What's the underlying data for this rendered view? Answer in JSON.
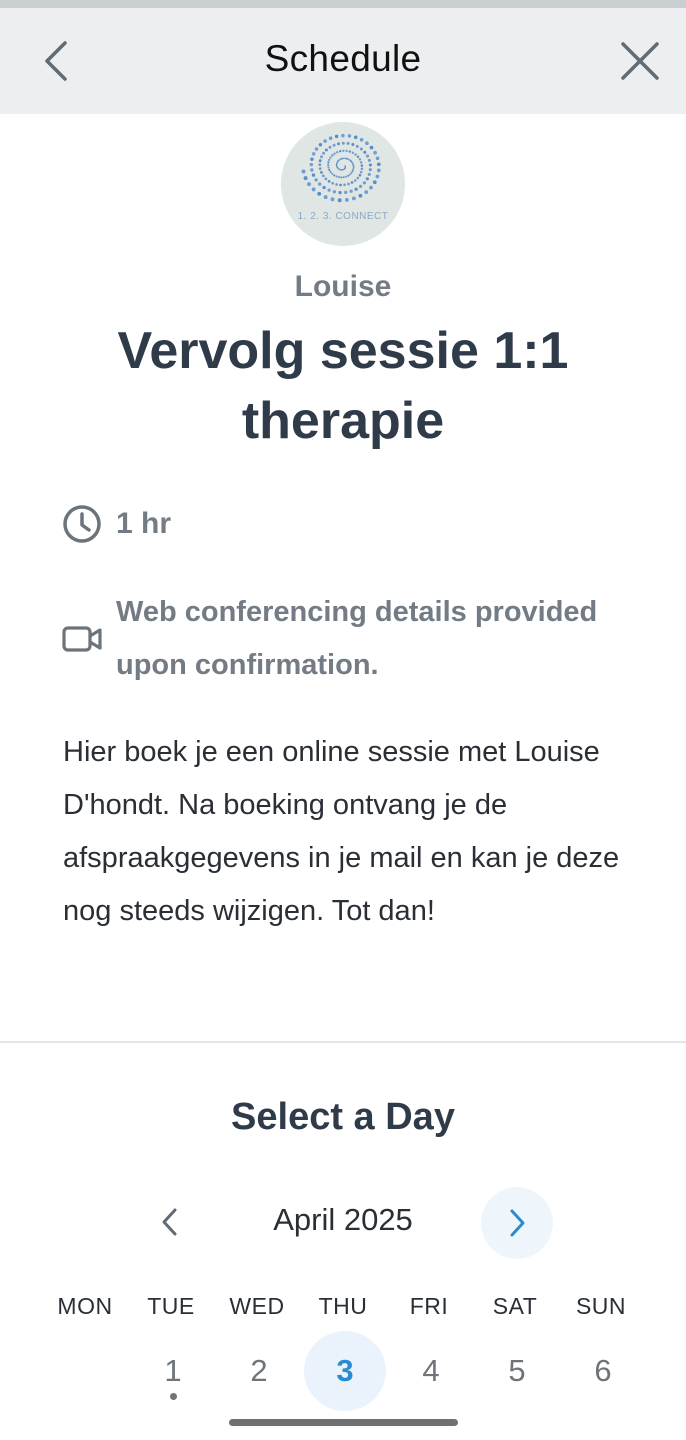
{
  "header": {
    "title": "Schedule"
  },
  "logo": {
    "text": "1. 2. 3. CONNECT"
  },
  "event": {
    "owner": "Louise",
    "title": "Vervolg sessie 1:1 therapie",
    "duration": "1 hr",
    "conferencing": "Web conferencing details provided upon confirmation.",
    "description": "Hier boek je een online sessie met Louise D'hondt. Na boeking ontvang je de afspraakgegevens in je mail en kan je deze nog steeds wijzigen. Tot dan!"
  },
  "calendar": {
    "heading": "Select a Day",
    "month": "April 2025",
    "weekdays": [
      "MON",
      "TUE",
      "WED",
      "THU",
      "FRI",
      "SAT",
      "SUN"
    ],
    "days": [
      "1",
      "2",
      "3",
      "4",
      "5",
      "6"
    ],
    "selected_day": "3",
    "accent_color": "#2a8bd0"
  }
}
